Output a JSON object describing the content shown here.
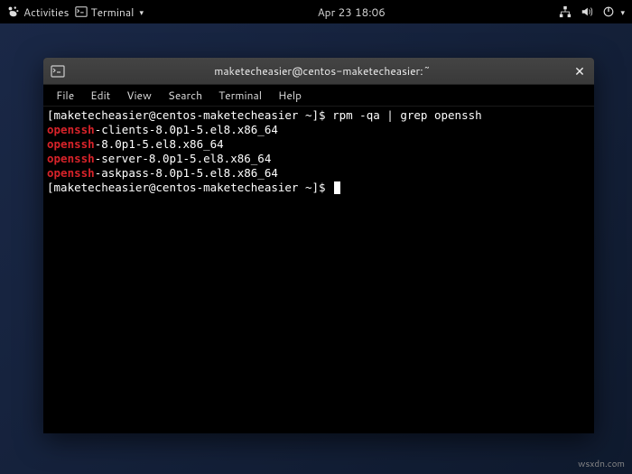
{
  "topbar": {
    "activities": "Activities",
    "app_icon": "terminal-icon",
    "app_label": "Terminal",
    "datetime": "Apr 23  18:06"
  },
  "window": {
    "title": "maketecheasier@centos-maketecheasier:~",
    "menu": {
      "file": "File",
      "edit": "Edit",
      "view": "View",
      "search": "Search",
      "terminal": "Terminal",
      "help": "Help"
    }
  },
  "terminal": {
    "prompt_line1_prefix": "[maketecheasier@centos-maketecheasier ~]$ ",
    "command": "rpm -qa | grep openssh",
    "lines": [
      {
        "hl": "openssh",
        "rest": "-clients-8.0p1-5.el8.x86_64"
      },
      {
        "hl": "openssh",
        "rest": "-8.0p1-5.el8.x86_64"
      },
      {
        "hl": "openssh",
        "rest": "-server-8.0p1-5.el8.x86_64"
      },
      {
        "hl": "openssh",
        "rest": "-askpass-8.0p1-5.el8.x86_64"
      }
    ],
    "prompt_line2": "[maketecheasier@centos-maketecheasier ~]$ "
  },
  "watermark": "wsxdn.com"
}
